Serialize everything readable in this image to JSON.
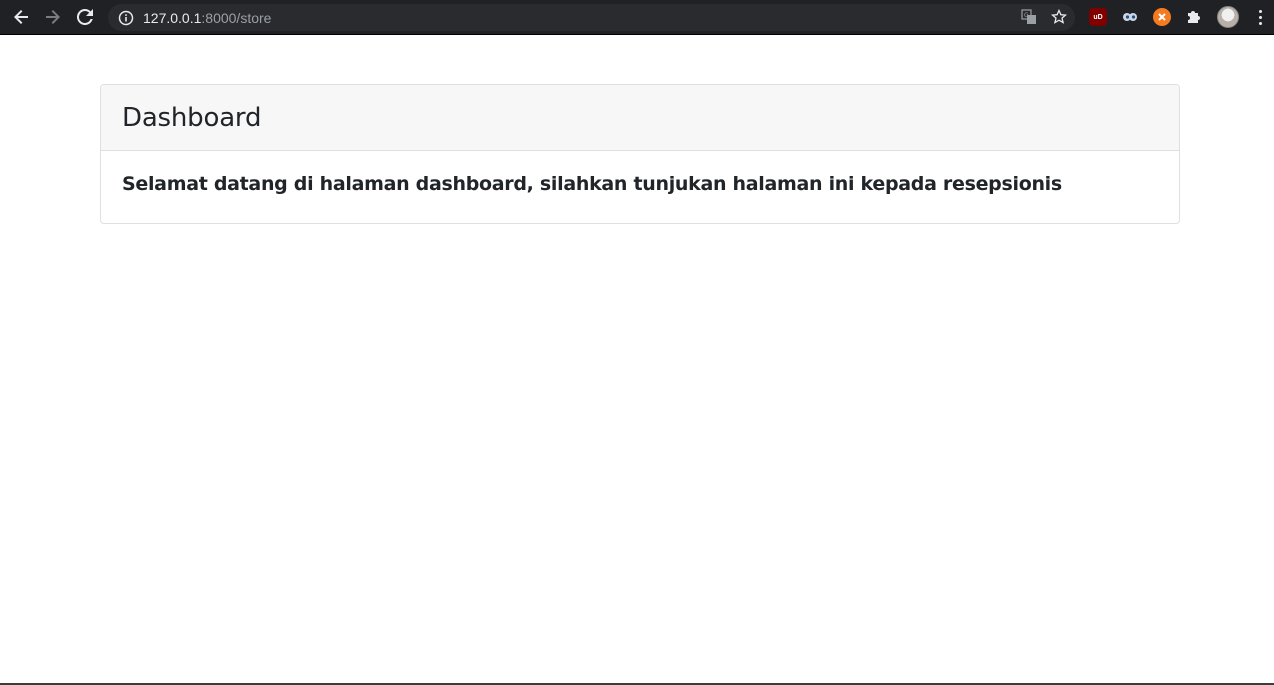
{
  "browser": {
    "url_host": "127.0.0.1",
    "url_rest": ":8000/store",
    "icons": {
      "back": "arrow-left-icon",
      "forward": "arrow-right-icon",
      "reload": "reload-icon",
      "info": "info-icon",
      "translate": "translate-icon",
      "bookmark": "star-icon",
      "extensions": "puzzle-icon",
      "menu": "kebab-menu-icon"
    },
    "extensions": [
      {
        "label": "uD",
        "color": "#800000"
      },
      {
        "label": "",
        "color": "#3b6ea5"
      },
      {
        "label": "",
        "color": "#f47b20"
      }
    ]
  },
  "card": {
    "title": "Dashboard",
    "body": "Selamat datang di halaman dashboard, silahkan tunjukan halaman ini kepada resepsionis"
  },
  "colors": {
    "header_bg": "#f7f7f7",
    "text": "#212529",
    "border": "#dfdfdf"
  }
}
